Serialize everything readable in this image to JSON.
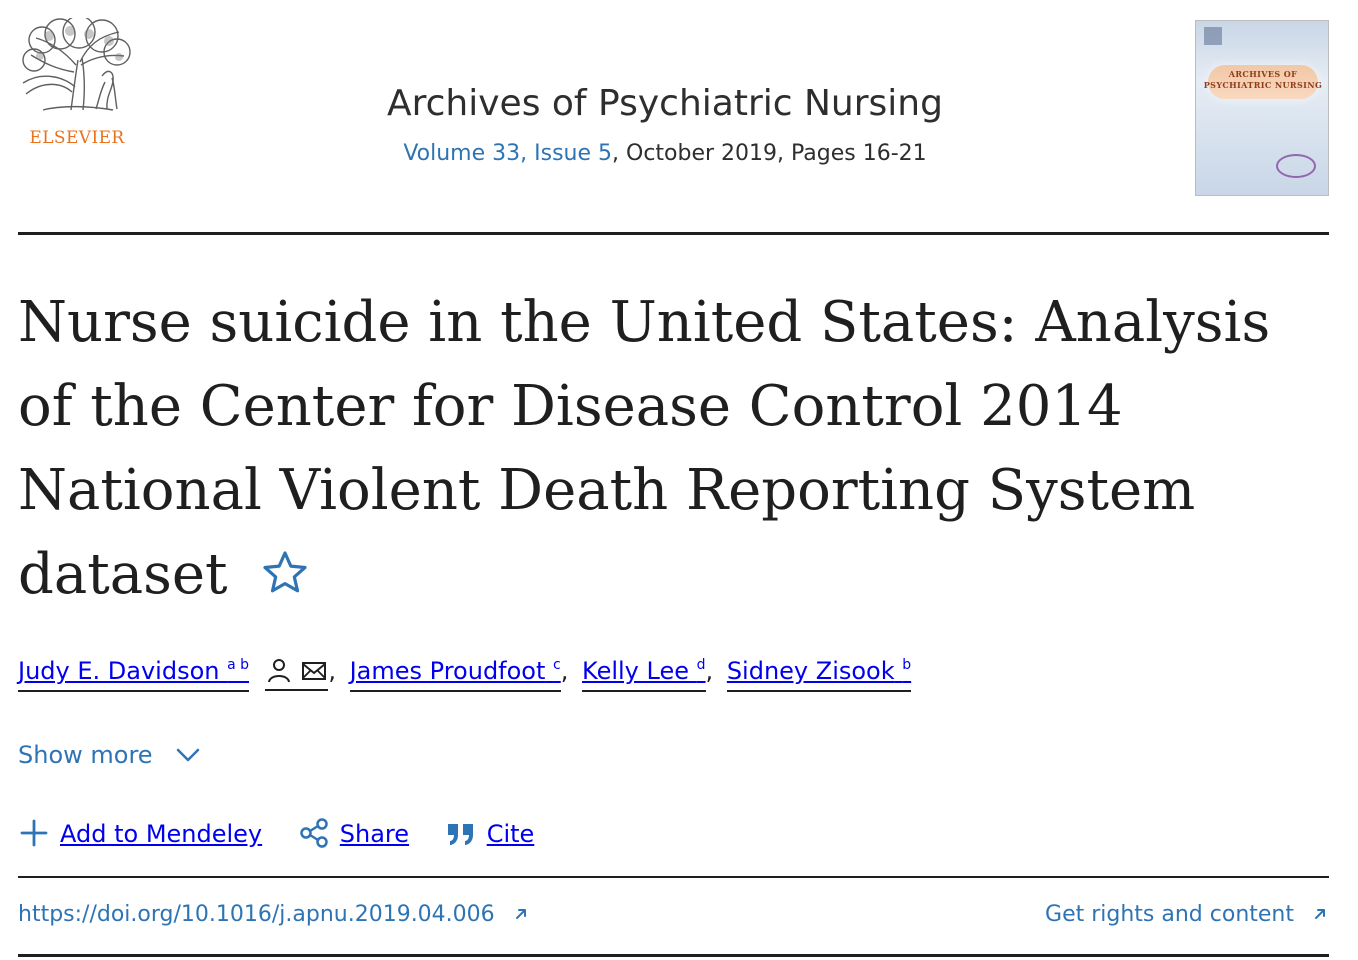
{
  "header": {
    "publisher_logo_text": "ELSEVIER",
    "journal_title": "Archives of Psychiatric Nursing",
    "volume_issue": "Volume 33, Issue 5",
    "issue_details": ", October 2019, Pages 16-21",
    "cover_title": "ARCHIVES OF\nPSYCHIATRIC NURSING"
  },
  "article": {
    "title": "Nurse suicide in the United States: Analysis of the Center for Disease Control 2014 National Violent Death Reporting System dataset"
  },
  "authors": [
    {
      "name": "Judy E. Davidson",
      "sup": "a b"
    },
    {
      "name": "James Proudfoot",
      "sup": "c"
    },
    {
      "name": "Kelly Lee",
      "sup": "d"
    },
    {
      "name": "Sidney Zisook",
      "sup": "b"
    }
  ],
  "separators": {
    "comma": ","
  },
  "controls": {
    "show_more": "Show more",
    "add_to_mendeley": "Add to Mendeley",
    "share": "Share",
    "cite": "Cite"
  },
  "links": {
    "doi": "https://doi.org/10.1016/j.apnu.2019.04.006",
    "rights": "Get rights and content"
  },
  "icons": {
    "star": "star-outline-icon",
    "user": "user-icon",
    "email": "email-icon",
    "chevron": "chevron-down-icon",
    "plus": "plus-icon",
    "share": "share-icon",
    "cite": "quote-icon",
    "external": "external-link-icon"
  },
  "colors": {
    "accent": "#2e74b5",
    "text": "#1f1f1f",
    "logo": "#e9711c"
  }
}
